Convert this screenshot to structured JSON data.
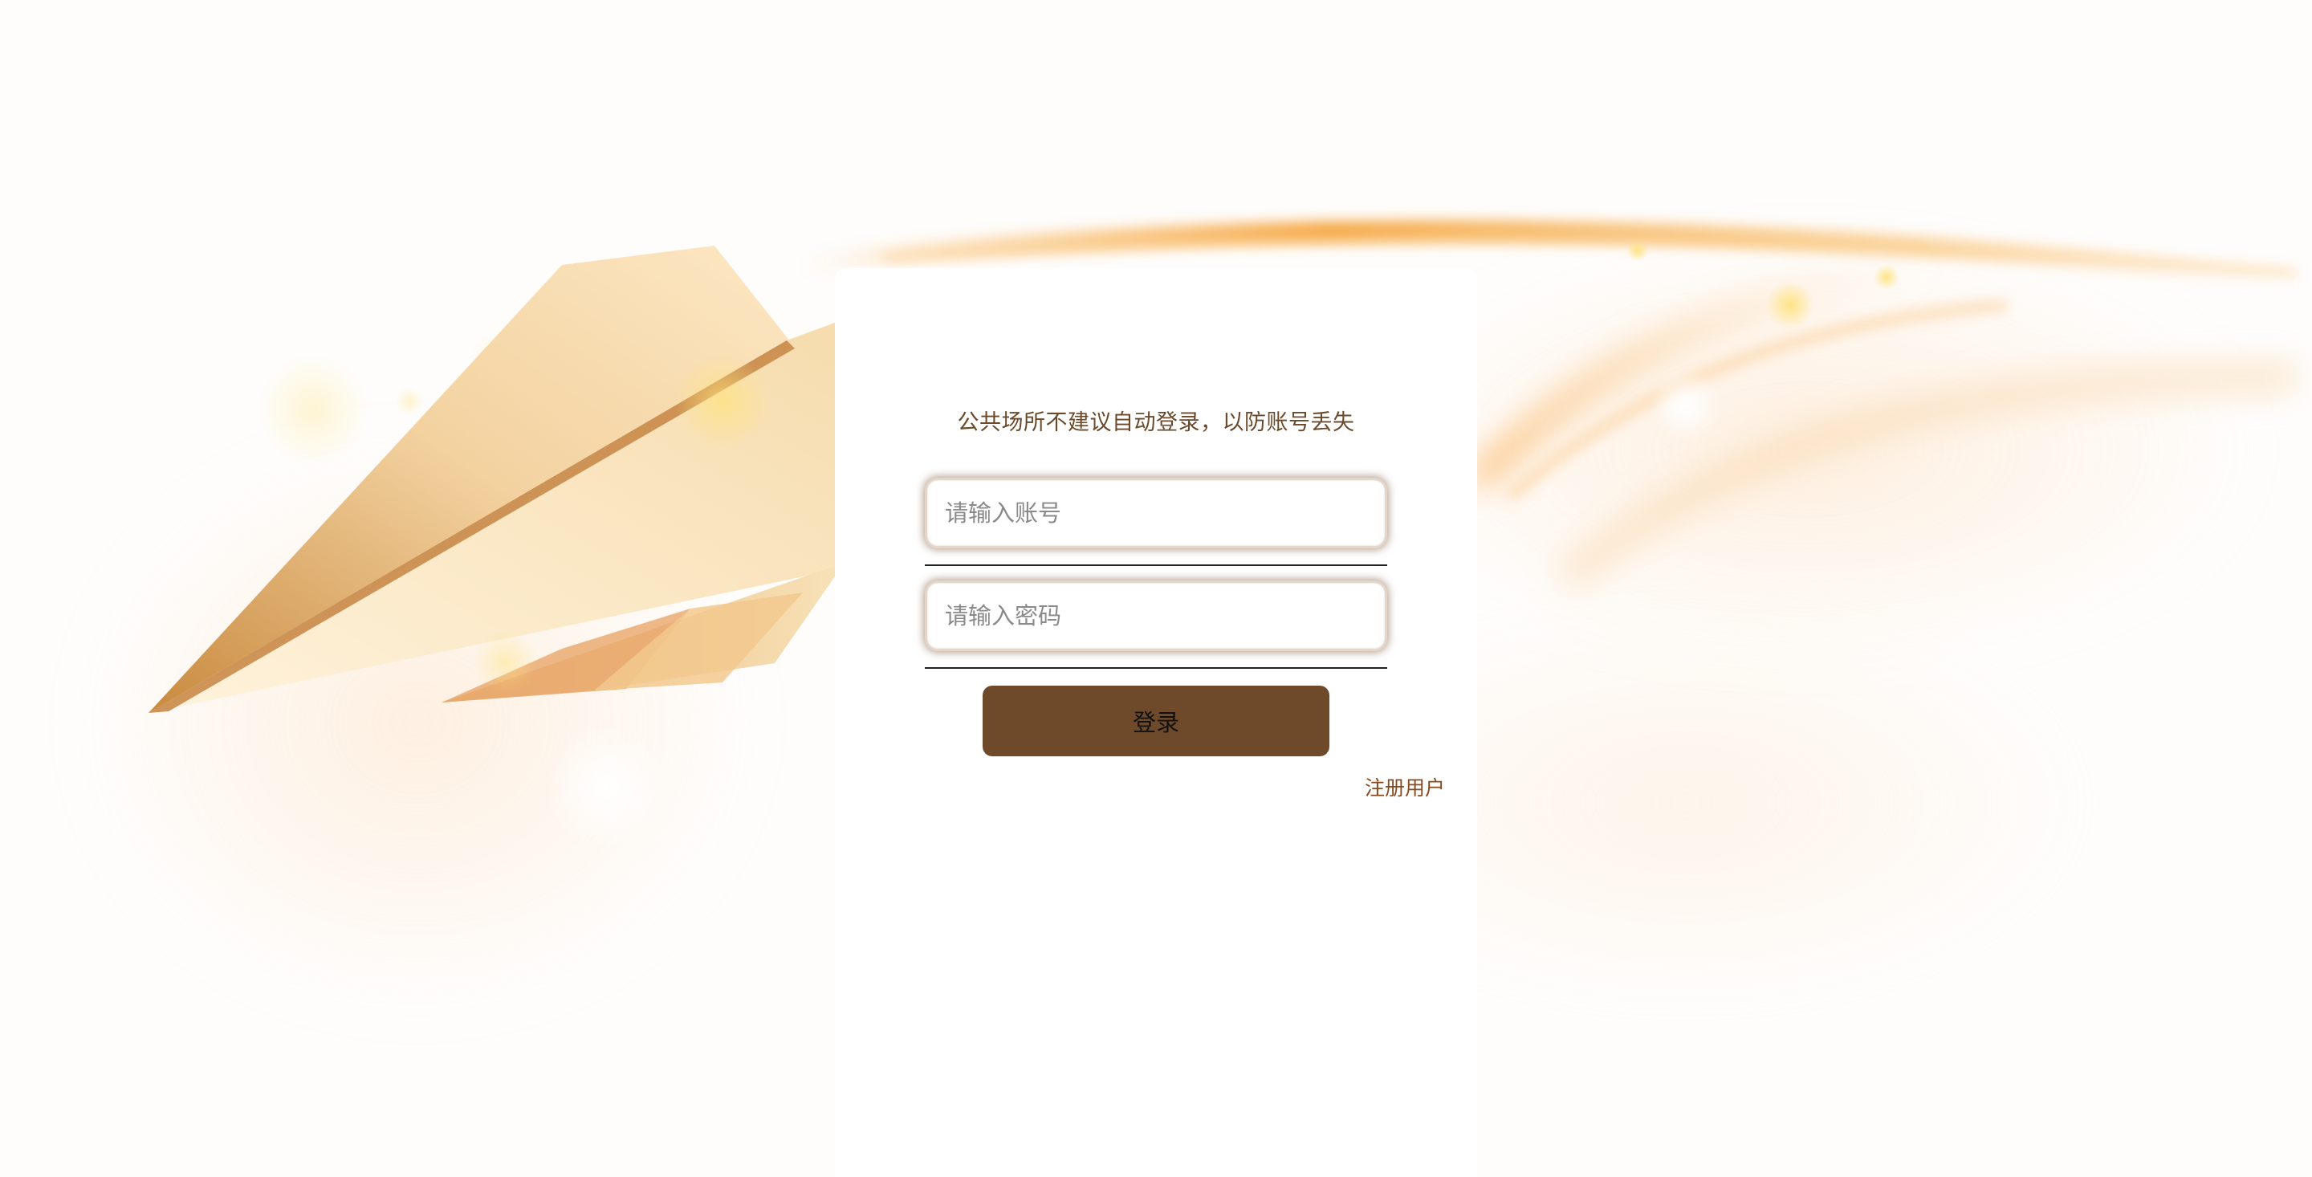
{
  "login": {
    "notice": "公共场所不建议自动登录，以防账号丢失",
    "account_placeholder": "请输入账号",
    "password_placeholder": "请输入密码",
    "login_label": "登录",
    "register_label": "注册用户"
  },
  "colors": {
    "accent": "#6e4a2b",
    "notice_text": "#6b4a2b",
    "link": "#8a4a1c",
    "glow_orange": "#f5a33c"
  },
  "icons": {
    "background_illustration": "paper-plane-illustration"
  }
}
